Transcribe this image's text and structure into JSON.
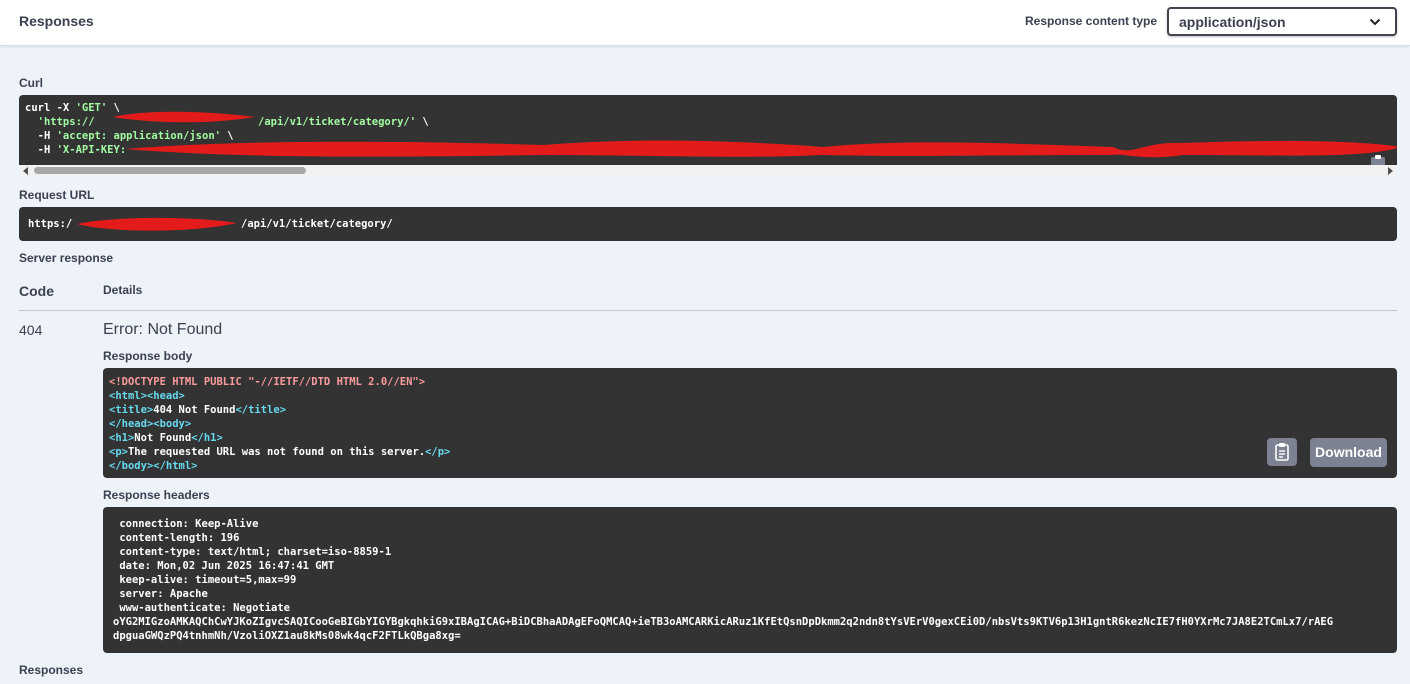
{
  "header": {
    "title": "Responses",
    "content_type_label": "Response content type",
    "content_type_value": "application/json"
  },
  "curl": {
    "label": "Curl",
    "lines": [
      "curl -X 'GET' \\",
      "  'https://",
      "/api/v1/ticket/category/' \\",
      "  -H 'accept: application/json' \\",
      "  -H 'X-API-KEY:"
    ],
    "method_str": "'GET'",
    "accept_str": "'accept: application/json'",
    "apikey_str": "'X-API-KEY:"
  },
  "request_url": {
    "label": "Request URL",
    "prefix": "https:/",
    "suffix": "/api/v1/ticket/category/"
  },
  "server_response": {
    "label": "Server response",
    "col_code": "Code",
    "col_details": "Details",
    "code": "404",
    "error": "Error: Not Found",
    "body_label": "Response body",
    "body": {
      "doctype": "<!DOCTYPE HTML PUBLIC \"-//IETF//DTD HTML 2.0//EN\">",
      "html_head": "<html><head>",
      "title_open": "<title>",
      "title_text": "404 Not Found",
      "title_close": "</title>",
      "head_body": "</head><body>",
      "h1_open": "<h1>",
      "h1_text": "Not Found",
      "h1_close": "</h1>",
      "p_open": "<p>",
      "p_text": "The requested URL was not found on this server.",
      "p_close": "</p>",
      "body_html_close": "</body></html>"
    },
    "download_label": "Download",
    "headers_label": "Response headers",
    "headers": [
      " connection: Keep-Alive",
      " content-length: 196",
      " content-type: text/html; charset=iso-8859-1",
      " date: Mon,02 Jun 2025 16:47:41 GMT",
      " keep-alive: timeout=5,max=99",
      " server: Apache",
      " www-authenticate: Negotiate",
      "oYG2MIGzoAMKAQChCwYJKoZIgvcSAQICooGeBIGbYIGYBgkqhkiG9xIBAgICAG+BiDCBhaADAgEFoQMCAQ+ieTB3oAMCARKicARuz1KfEtQsnDpDkmm2q2ndn8tYsVErV0gexCEi0D/nbsVts9KTV6p13H1gntR6kezNcIE7fH0YXrMc7JA8E2TCmLx7/rAEG",
      "dpguaGWQzPQ4tnhmNh/VzoliOXZ1au8kMs08wk4qcF2FTLkQBga8xg="
    ]
  },
  "footer": {
    "responses_label": "Responses"
  },
  "colors": {
    "code_bg": "#333333",
    "page_bg": "#eef3f9",
    "string_green": "#a2fca2",
    "tag_blue": "#66d9ef",
    "doctype_red": "#fc9b9b",
    "button_gray": "#7d8293",
    "redaction_red": "#e31b1b"
  },
  "icons": {
    "select_arrow": "chevron-down-icon",
    "copy": "clipboard-icon"
  }
}
